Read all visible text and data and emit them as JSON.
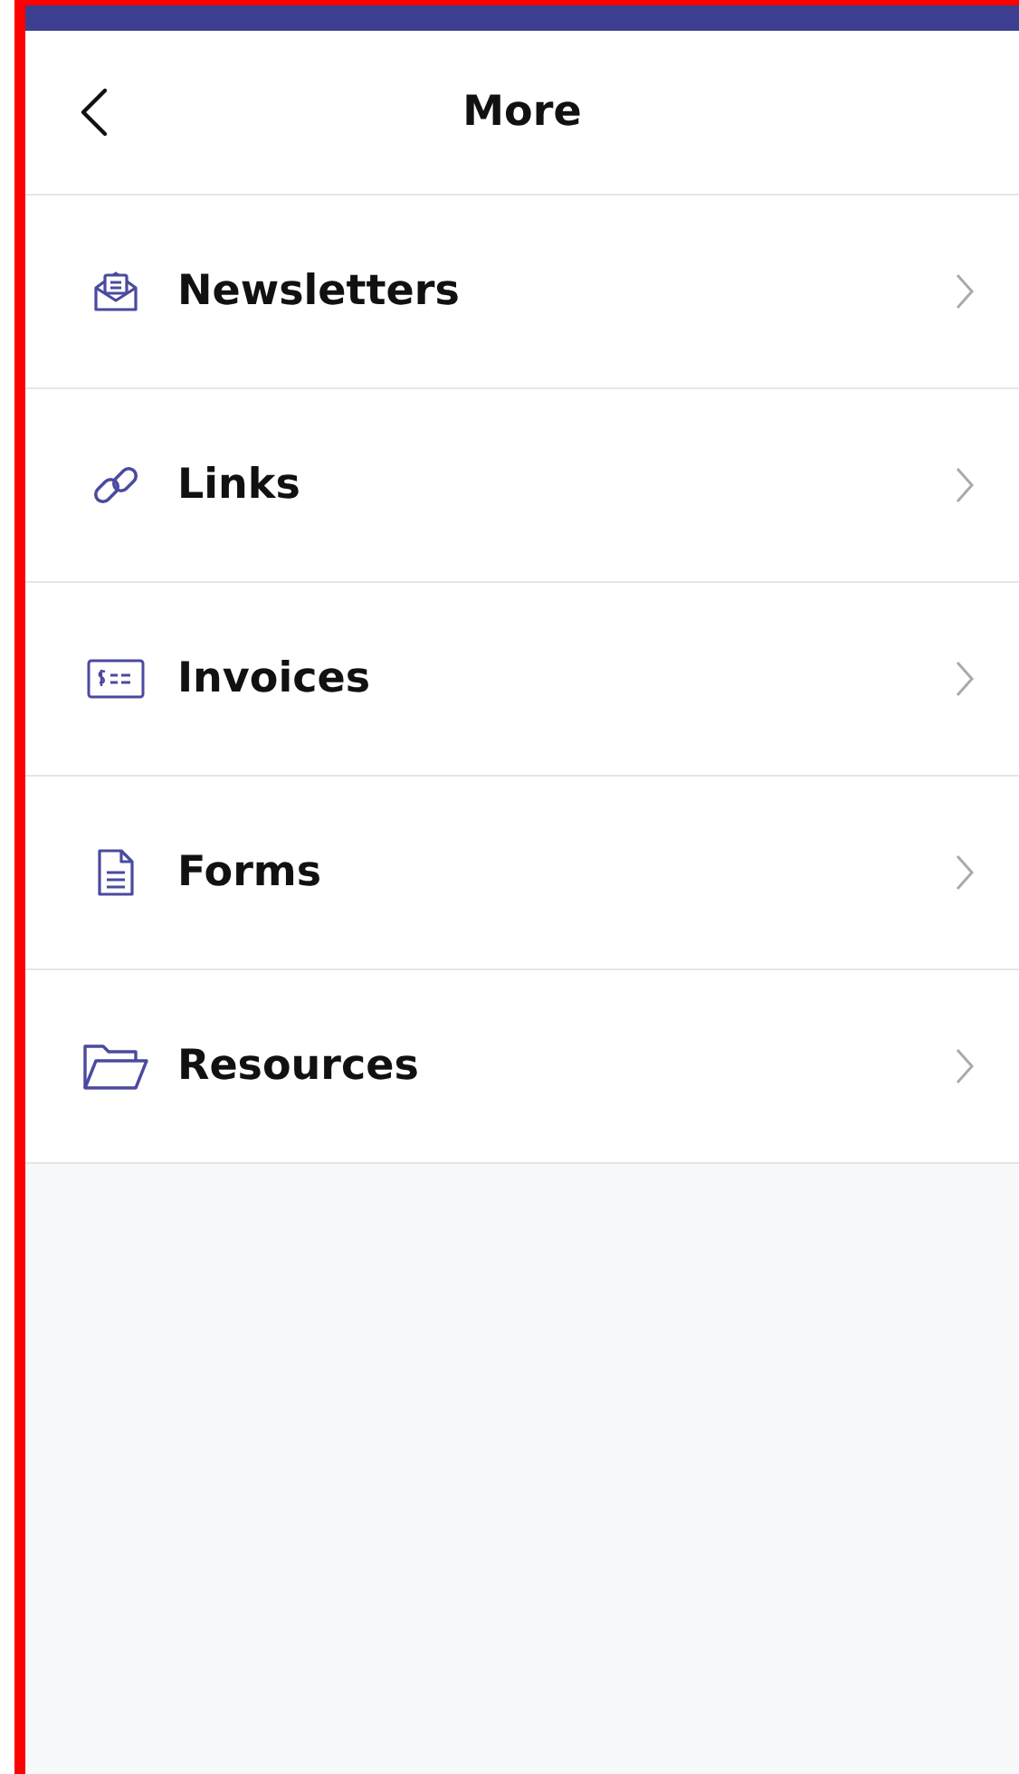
{
  "header": {
    "title": "More"
  },
  "items": [
    {
      "kind": "newsletter",
      "label": "Newsletters"
    },
    {
      "kind": "link",
      "label": "Links"
    },
    {
      "kind": "invoice",
      "label": "Invoices"
    },
    {
      "kind": "form",
      "label": "Forms"
    },
    {
      "kind": "folder",
      "label": "Resources"
    }
  ]
}
